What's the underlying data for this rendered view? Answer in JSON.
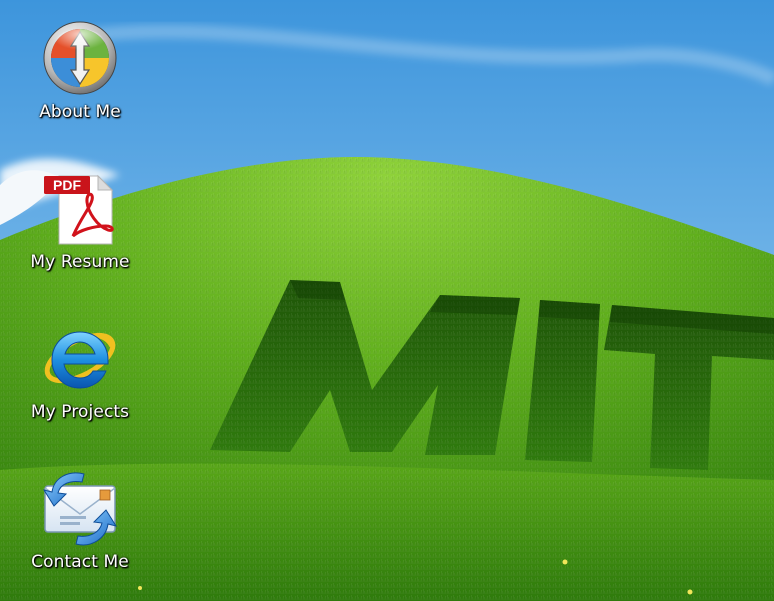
{
  "desktop": {
    "wallpaper": {
      "text": "MIT",
      "sky_color": "#4a9fe0",
      "grass_color": "#3f8f12"
    },
    "icons": [
      {
        "label": "About Me",
        "icon": "windows-orb-icon"
      },
      {
        "label": "My Resume",
        "icon": "pdf-document-icon"
      },
      {
        "label": "My Projects",
        "icon": "internet-explorer-icon"
      },
      {
        "label": "Contact Me",
        "icon": "email-exchange-icon"
      }
    ]
  }
}
